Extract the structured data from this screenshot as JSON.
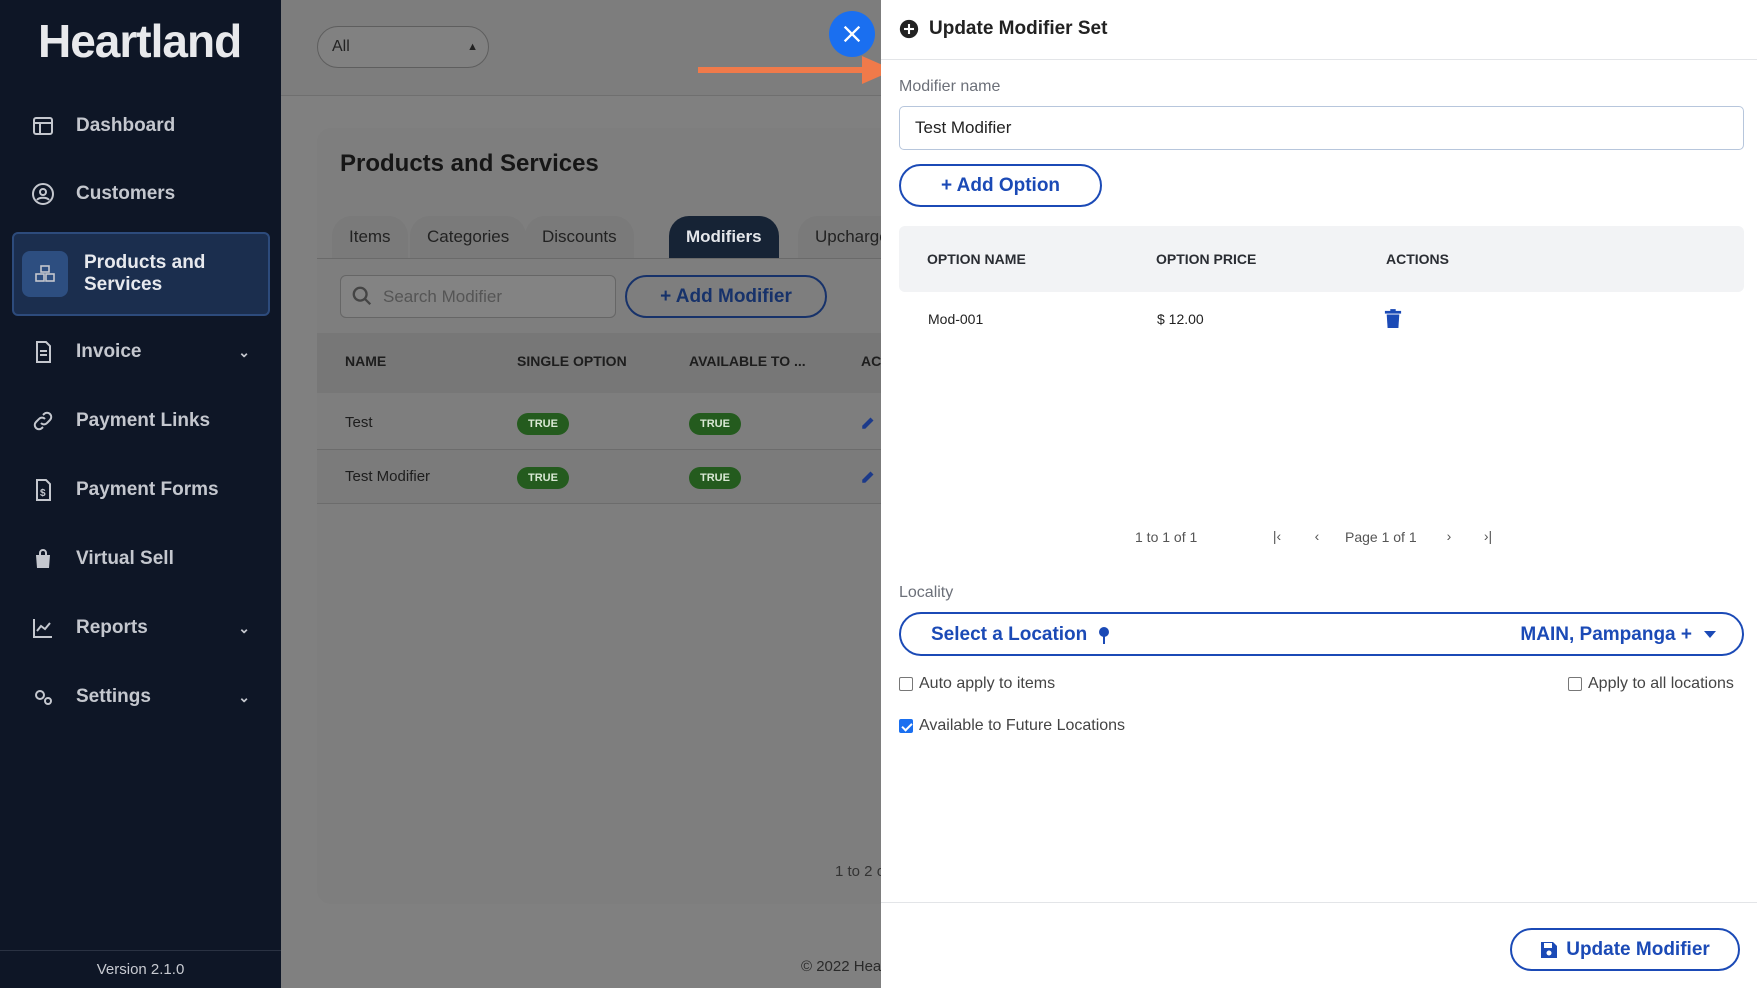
{
  "app": {
    "logo": "Heartland",
    "version": "Version 2.1.0"
  },
  "sidebar": {
    "items": [
      {
        "label": "Dashboard",
        "icon": "dashboard-icon"
      },
      {
        "label": "Customers",
        "icon": "user-circle-icon"
      },
      {
        "label": "Products and Services",
        "icon": "boxes-icon",
        "active": true
      },
      {
        "label": "Invoice",
        "icon": "file-icon",
        "has_children": true
      },
      {
        "label": "Payment Links",
        "icon": "link-icon"
      },
      {
        "label": "Payment Forms",
        "icon": "file-dollar-icon"
      },
      {
        "label": "Virtual Sell",
        "icon": "shopping-bag-icon"
      },
      {
        "label": "Reports",
        "icon": "chart-line-icon",
        "has_children": true
      },
      {
        "label": "Settings",
        "icon": "gears-icon",
        "has_children": true
      }
    ]
  },
  "topbar": {
    "filter_value": "All"
  },
  "main": {
    "title": "Products and Services",
    "tabs": [
      "Items",
      "Categories",
      "Discounts",
      "Modifiers",
      "Upcharge"
    ],
    "active_tab": "Modifiers",
    "search_placeholder": "Search Modifier",
    "add_button": "Add Modifier",
    "table": {
      "headers": [
        "NAME",
        "SINGLE OPTION",
        "AVAILABLE TO ...",
        "AC"
      ],
      "rows": [
        {
          "name": "Test",
          "single_option": "TRUE",
          "available": "TRUE"
        },
        {
          "name": "Test Modifier",
          "single_option": "TRUE",
          "available": "TRUE"
        }
      ]
    },
    "pager": "1 to 2 o",
    "copyright": "© 2022 Hea"
  },
  "drawer": {
    "title": "Update Modifier Set",
    "modifier_name_label": "Modifier name",
    "modifier_name_value": "Test Modifier",
    "add_option_label": "+ Add Option",
    "options_table": {
      "headers": [
        "OPTION NAME",
        "OPTION PRICE",
        "ACTIONS"
      ],
      "rows": [
        {
          "name": "Mod-001",
          "price": "$ 12.00"
        }
      ]
    },
    "pager": {
      "range": "1 to 1 of 1",
      "page": "Page 1 of 1"
    },
    "locality_label": "Locality",
    "location_placeholder": "Select a Location",
    "location_selected": "MAIN, Pampanga +",
    "auto_apply_label": "Auto apply to items",
    "auto_apply_checked": false,
    "apply_all_label": "Apply to all locations",
    "apply_all_checked": false,
    "future_locations_label": "Available to Future Locations",
    "future_locations_checked": true,
    "update_button": "Update Modifier"
  },
  "colors": {
    "accent": "#1b4ab6",
    "close_button": "#1a6ff0",
    "arrow": "#f07a4a",
    "sidebar_bg": "#0e1626",
    "badge_green": "#245b1e"
  }
}
